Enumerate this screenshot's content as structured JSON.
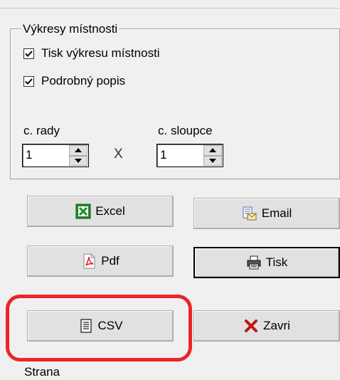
{
  "group": {
    "title": "Výkresy místnosti",
    "print_drawing": {
      "label": "Tisk výkresu místnosti",
      "checked": true
    },
    "detailed_desc": {
      "label": "Podrobný popis",
      "checked": true
    },
    "rows": {
      "label": "c. rady",
      "value": "1"
    },
    "columns": {
      "label": "c. sloupce",
      "value": "1"
    },
    "times_sign": "X"
  },
  "buttons": {
    "excel": "Excel",
    "email": "Email",
    "pdf": "Pdf",
    "print": "Tisk",
    "csv": "CSV",
    "close": "Zavri"
  },
  "footer": {
    "page_label": "Strana"
  },
  "colors": {
    "highlight": "#e8262b",
    "excel_green": "#1a8a2a",
    "close_red": "#c21414",
    "pdf_red": "#d71920"
  },
  "icons": [
    "checkmark-icon",
    "spin-up-icon",
    "spin-down-icon",
    "excel-icon",
    "email-icon",
    "pdf-icon",
    "printer-icon",
    "csv-document-icon",
    "close-x-icon"
  ]
}
